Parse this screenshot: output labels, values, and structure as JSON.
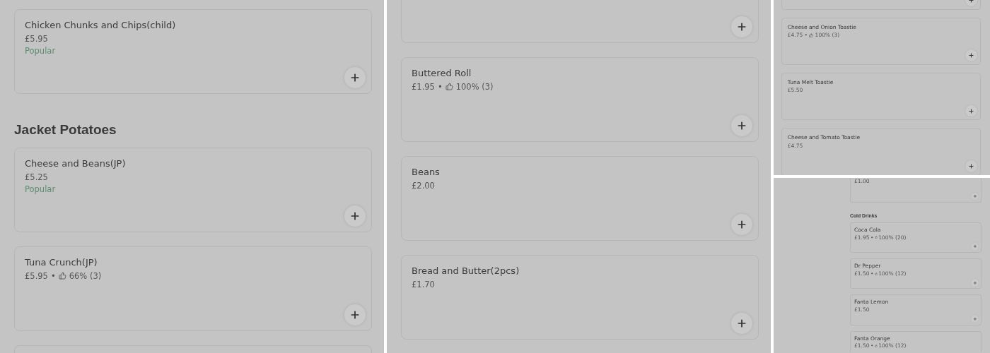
{
  "panels": [
    {
      "items": [
        {
          "kind": "card",
          "name": "Chicken Chunks and Chips(child)",
          "price": "£5.95",
          "badge": "Popular"
        },
        {
          "kind": "section",
          "title": "Jacket Potatoes"
        },
        {
          "kind": "card",
          "name": "Cheese and Beans(JP)",
          "price": "£5.25",
          "badge": "Popular"
        },
        {
          "kind": "card",
          "name": "Tuna Crunch(JP)",
          "price": "£5.95",
          "rating": {
            "separator": "•",
            "value": "66% (3)"
          }
        },
        {
          "kind": "card_cut_bottom"
        }
      ]
    },
    {
      "items": [
        {
          "kind": "card_cut_top"
        },
        {
          "kind": "card",
          "name": "Buttered Roll",
          "price": "£1.95",
          "rating": {
            "separator": "•",
            "value": "100% (3)"
          }
        },
        {
          "kind": "card",
          "name": "Beans",
          "price": "£2.00"
        },
        {
          "kind": "card",
          "name": "Bread and Butter(2pcs)",
          "price": "£1.70"
        }
      ]
    },
    {
      "items": [
        {
          "kind": "card_cut_top"
        },
        {
          "kind": "card",
          "name": "Cheese and Onion Toastie",
          "price": "£4.75",
          "rating": {
            "separator": "•",
            "value": "100% (3)"
          }
        },
        {
          "kind": "card",
          "name": "Tuna Melt Toastie",
          "price": "£5.50"
        },
        {
          "kind": "card",
          "name": "Cheese and Tomato Toastie",
          "price": "£4.75"
        }
      ]
    },
    {
      "items": [
        {
          "kind": "card_cut_top",
          "price": "£1.00"
        },
        {
          "kind": "section",
          "title": "Cold Drinks"
        },
        {
          "kind": "card",
          "name": "Coca Cola",
          "price": "£1.95",
          "rating": {
            "separator": "•",
            "value": "100% (20)"
          }
        },
        {
          "kind": "card",
          "name": "Dr Pepper",
          "price": "£1.50",
          "rating": {
            "separator": "•",
            "value": "100% (12)"
          }
        },
        {
          "kind": "card",
          "name": "Fanta Lemon",
          "price": "£1.50"
        },
        {
          "kind": "card_cut_bottom",
          "name": "Fanta Orange",
          "price": "£1.50",
          "rating": {
            "separator": "•",
            "value": "100% (12)"
          }
        }
      ]
    }
  ]
}
